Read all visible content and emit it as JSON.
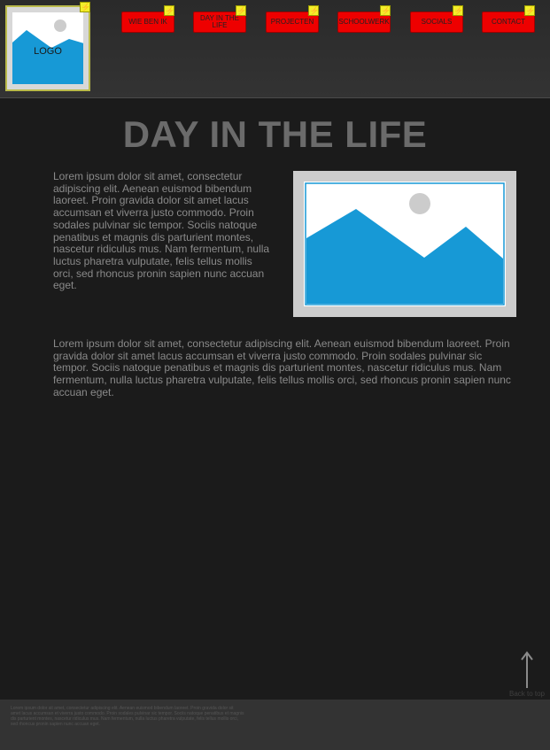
{
  "header": {
    "logo_label": "LOGO",
    "nav": [
      {
        "label": "WIE BEN IK"
      },
      {
        "label": "DAY IN THE LIFE"
      },
      {
        "label": "PROJECTEN"
      },
      {
        "label": "SCHOOLWERK"
      },
      {
        "label": "SOCIALS"
      },
      {
        "label": "CONTACT"
      }
    ],
    "badge_icon": "lightning-bolt-icon"
  },
  "main": {
    "title": "DAY IN THE LIFE",
    "paragraph_1": "Lorem ipsum dolor sit amet, consectetur adipiscing elit. Aenean euismod bibendum laoreet. Proin gravida dolor sit amet lacus accumsan et viverra justo commodo. Proin sodales pulvinar sic tempor. Sociis natoque penatibus et magnis dis parturient montes, nascetur ridiculus mus. Nam fermentum, nulla luctus pharetra vulputate, felis tellus mollis orci, sed rhoncus pronin sapien nunc accuan eget.",
    "paragraph_2": "Lorem ipsum dolor sit amet, consectetur adipiscing elit. Aenean euismod bibendum laoreet. Proin gravida dolor sit amet lacus accumsan et viverra justo commodo. Proin sodales pulvinar sic tempor. Sociis natoque penatibus et magnis dis parturient montes, nascetur ridiculus mus. Nam fermentum, nulla luctus pharetra vulputate, felis tellus mollis orci, sed rhoncus pronin sapien nunc accuan eget.",
    "image_icon": "image-placeholder-icon"
  },
  "back_to_top": {
    "label": "Back to top",
    "icon": "arrow-up-icon"
  },
  "footer": {
    "text": "Lorem ipsum dolor sit amet, consectetur adipiscing elit. Aenean euismod bibendum laoreet. Proin gravida dolor sit amet lacus accumsan et viverra justo commodo. Proin sodales pulvinar sic tempor. Sociis natoque penatibus et magnis dis parturient montes, nascetur ridiculus mus. Nam fermentum, nulla luctus pharetra vulputate, felis tellus mollis orci, sed rhoncus pronin sapien nunc accuan eget."
  },
  "colors": {
    "background": "#1b1b1b",
    "header": "#333333",
    "nav_button": "#ee0000",
    "badge": "#f2ef2a",
    "image_blue": "#1799d6",
    "title": "#6b6b6b"
  }
}
